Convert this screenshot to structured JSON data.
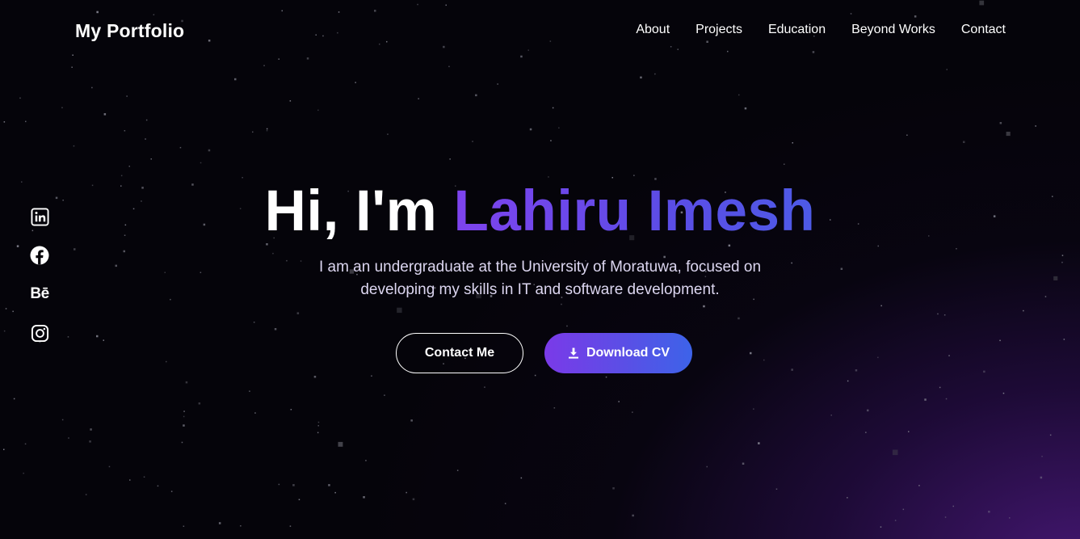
{
  "brand": "My Portfolio",
  "nav": [
    {
      "label": "About"
    },
    {
      "label": "Projects"
    },
    {
      "label": "Education"
    },
    {
      "label": "Beyond Works"
    },
    {
      "label": "Contact"
    }
  ],
  "socials": [
    {
      "icon": "linkedin-icon"
    },
    {
      "icon": "facebook-icon"
    },
    {
      "icon": "behance-icon",
      "text": "Bē"
    },
    {
      "icon": "instagram-icon"
    }
  ],
  "hero": {
    "greeting": "Hi, I'm ",
    "name": "Lahiru Imesh",
    "tagline": "I am an undergraduate at the University of Moratuwa, focused on developing my skills in IT and software development."
  },
  "buttons": {
    "contact": "Contact Me",
    "download": "Download CV",
    "download_icon": "download-icon"
  },
  "colors": {
    "background": "#05040a",
    "accent_start": "#7e43ee",
    "accent_end": "#3d63e9",
    "glow": "#4e1a82"
  }
}
